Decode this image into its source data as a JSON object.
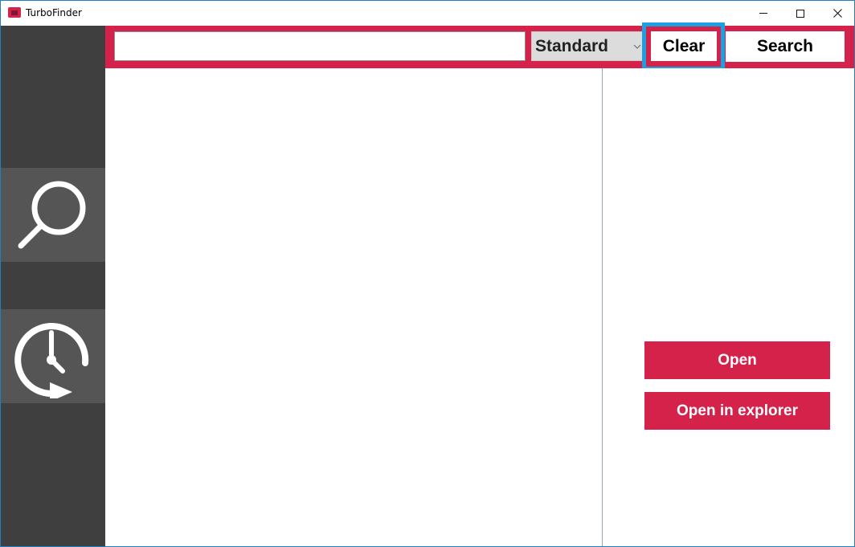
{
  "window": {
    "title": "TurboFinder"
  },
  "titlebar_controls": [
    "minimize",
    "maximize",
    "close"
  ],
  "sidebar": {
    "items": [
      {
        "id": "search",
        "icon": "magnifier-icon"
      },
      {
        "id": "history",
        "icon": "clock-history-icon"
      }
    ]
  },
  "searchbar": {
    "query_value": "",
    "query_placeholder": "",
    "mode_selected": "Standard",
    "clear_label": "Clear",
    "search_label": "Search"
  },
  "detail": {
    "open_label": "Open",
    "open_explorer_label": "Open in explorer"
  },
  "colors": {
    "accent": "#d4224a",
    "sidebar_bg": "#3f3f3f",
    "sidebar_item_bg": "#555555",
    "focus_ring": "#1ba1e2"
  }
}
